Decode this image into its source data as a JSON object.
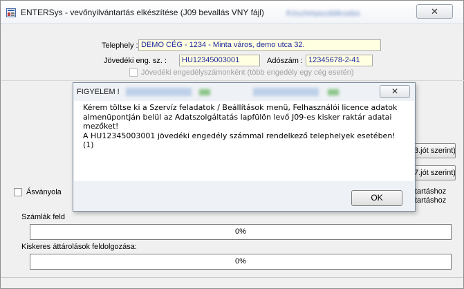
{
  "window": {
    "title": "ENTERSys - vevőnyilvántartás elkészítése (J09 bevallás VNY fájl)",
    "title_blurred": "Készletgazdálkodás",
    "close_glyph": "✕"
  },
  "form": {
    "telephely_label": "Telephely :",
    "telephely_value": "DEMO CÉG - 1234 - Minta város, demo utca 32.",
    "jovedeki_label": "Jövedéki eng. sz. :",
    "jovedeki_value": "HU12345003001",
    "adoszam_label": "Adószám :",
    "adoszam_value": "12345678-2-41",
    "engedely_checkbox_label": "Jövedéki engedélyszámonként (több engedély egy cég esetén)"
  },
  "side_buttons": {
    "btn1_label": "3.jót szerint)",
    "btn2_label": "7.jót szerint)"
  },
  "options": {
    "asvanyolaj_label": "Ásványola",
    "right_text_1": "tartáshoz",
    "right_text_2": "tartáshoz"
  },
  "progress": {
    "szamlak_label": "Számlák feld",
    "szamlak_value": "0%",
    "kiskeres_label": "Kiskeres áttárolások feldolgozása:",
    "kiskeres_value": "0%"
  },
  "dialog": {
    "title": "FIGYELEM !",
    "close_glyph": "✕",
    "message_lines": [
      "Kérem töltse ki a Szervíz feladatok / Beállítások menü, Felhasználói licence adatok",
      "almenüpontján belül az Adatszolgáltatás lapfülön levő J09-es kisker raktár adatai",
      "mezőket!",
      "A HU12345003001 jövedéki engedély számmal rendelkező telephelyek esetében!",
      "(1)"
    ],
    "ok_label": "OK"
  }
}
